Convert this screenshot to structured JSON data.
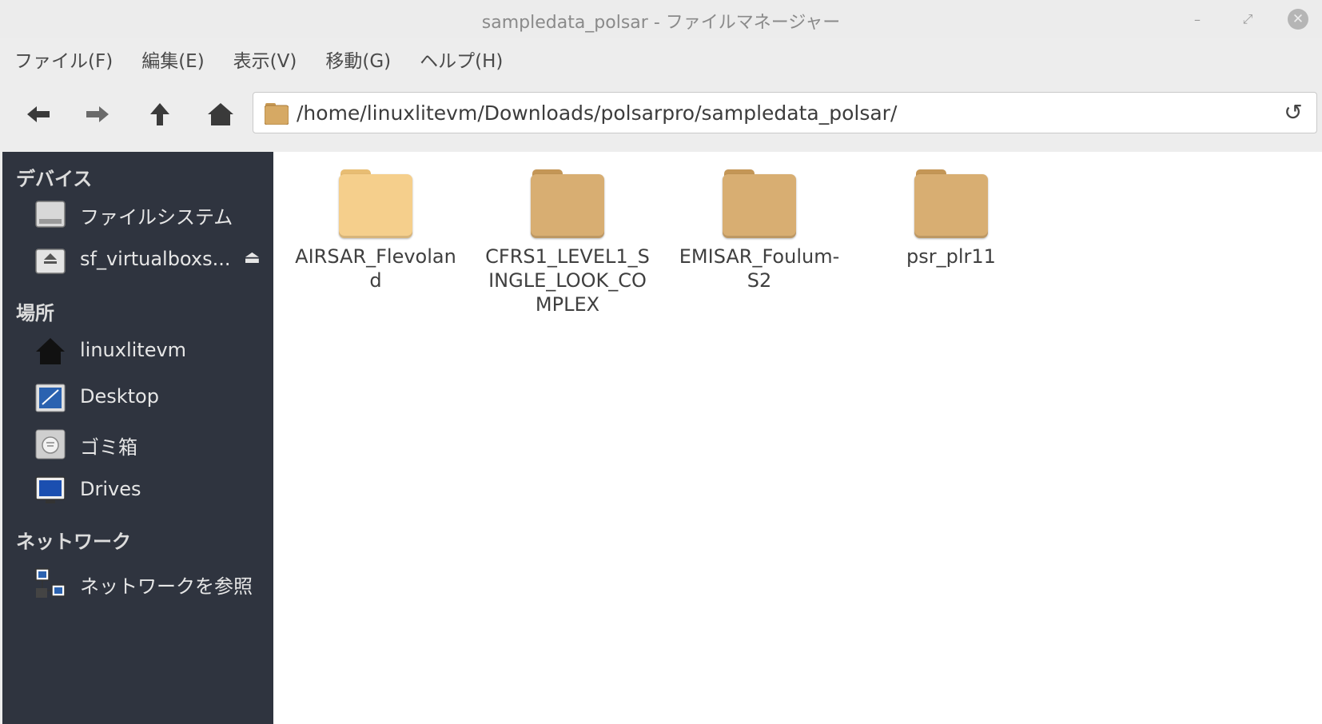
{
  "window": {
    "title": "sampledata_polsar - ファイルマネージャー",
    "minimize": "–",
    "maximize": "⤢",
    "close": "✕"
  },
  "menubar": {
    "items": [
      {
        "label": "ファイル(F)"
      },
      {
        "label": "編集(E)"
      },
      {
        "label": "表示(V)"
      },
      {
        "label": "移動(G)"
      },
      {
        "label": "ヘルプ(H)"
      }
    ]
  },
  "toolbar": {
    "path": "/home/linuxlitevm/Downloads/polsarpro/sampledata_polsar/",
    "reload_glyph": "↺",
    "icons": [
      "back-icon",
      "forward-icon",
      "up-icon",
      "home-icon"
    ]
  },
  "sidebar": {
    "sections": {
      "devices": "デバイス",
      "places": "場所",
      "network": "ネットワーク"
    },
    "devices": [
      {
        "label": "ファイルシステム",
        "icon": "drive-icon"
      },
      {
        "label": "sf_virtualboxs...",
        "icon": "removable-drive-icon",
        "eject": "⏏"
      }
    ],
    "places": [
      {
        "label": "linuxlitevm",
        "icon": "home-icon"
      },
      {
        "label": "Desktop",
        "icon": "desktop-icon"
      },
      {
        "label": "ゴミ箱",
        "icon": "trash-icon"
      },
      {
        "label": "Drives",
        "icon": "monitor-icon"
      }
    ],
    "network": [
      {
        "label": "ネットワークを参照",
        "icon": "network-icon"
      }
    ]
  },
  "files": [
    {
      "name": "AIRSAR_Flevoland",
      "color": "#f5cf8c"
    },
    {
      "name": "CFRS1_LEVEL1_SINGLE_LOOK_COMPLEX",
      "color": "#d8ae72"
    },
    {
      "name": "EMISAR_Foulum-S2",
      "color": "#d8ae72"
    },
    {
      "name": "psr_plr11",
      "color": "#d8ae72"
    }
  ],
  "colors": {
    "sidebar_bg": "#2f343f",
    "folder_light": "#f5cf8c",
    "folder_dark": "#d8ae72"
  }
}
